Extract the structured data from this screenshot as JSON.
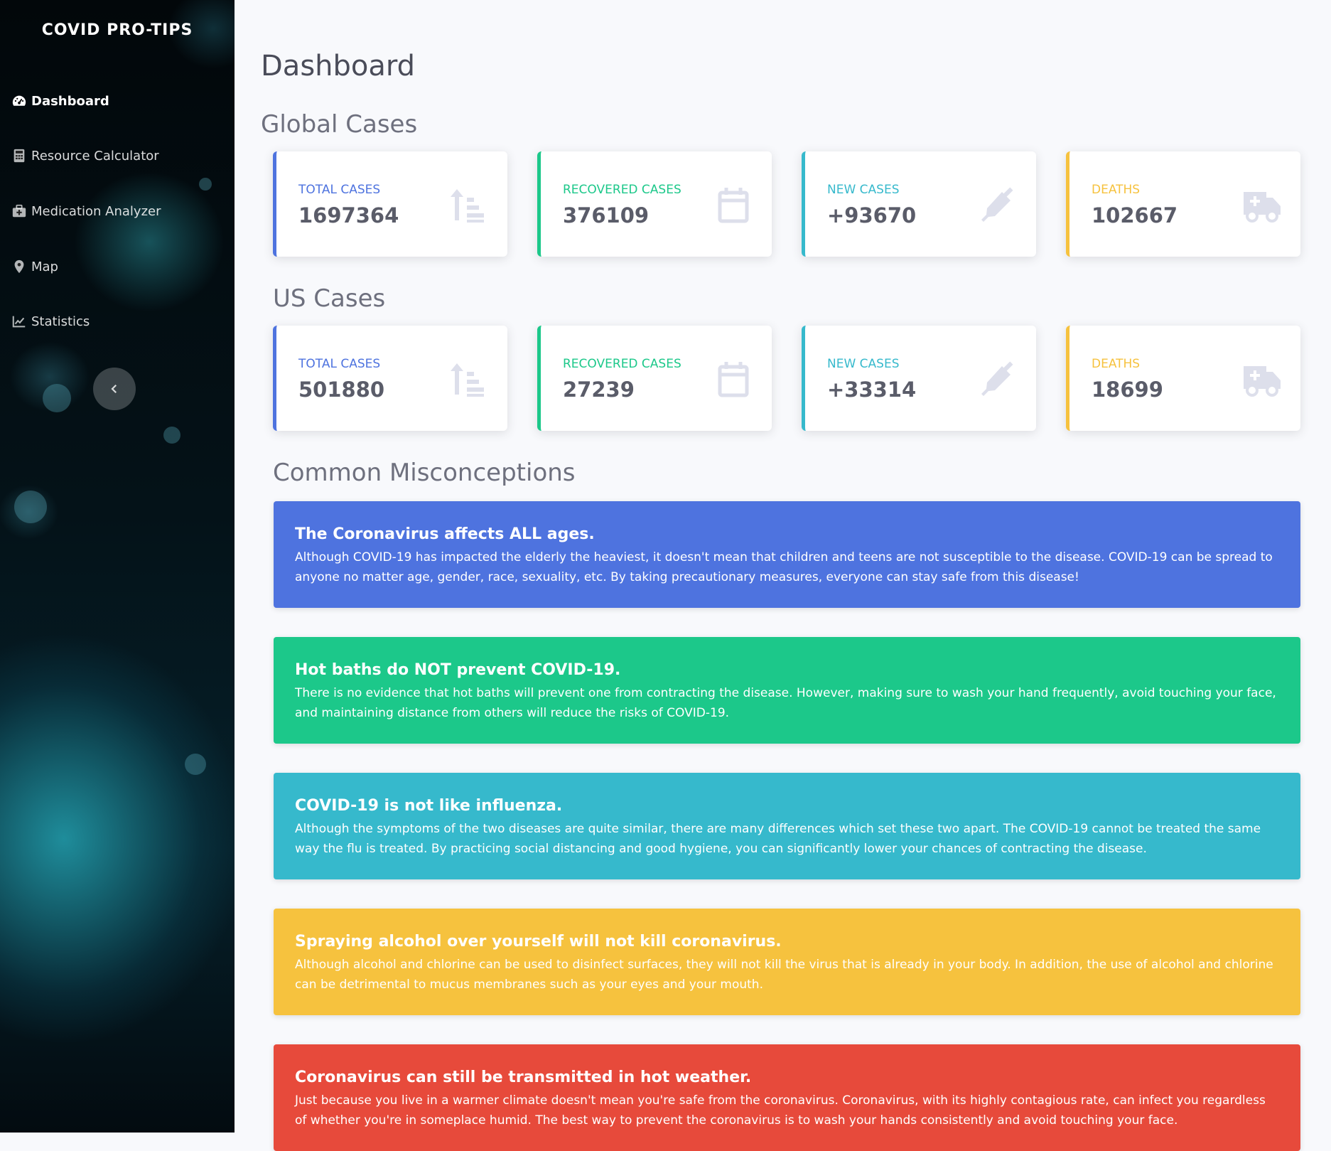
{
  "brand": "COVID PRO-TIPS",
  "sidebar": {
    "items": [
      {
        "label": "Dashboard",
        "icon": "tachometer-icon",
        "active": true
      },
      {
        "label": "Resource Calculator",
        "icon": "calculator-icon"
      },
      {
        "label": "Medication Analyzer",
        "icon": "medkit-icon"
      },
      {
        "label": "Map",
        "icon": "map-marker-icon"
      },
      {
        "label": "Statistics",
        "icon": "chart-line-icon"
      }
    ],
    "toggle_icon": "chevron-left-icon"
  },
  "page_title": "Dashboard",
  "global": {
    "title": "Global Cases",
    "cards": [
      {
        "label": "TOTAL CASES",
        "value": "1697364",
        "icon": "sort-amount-up-icon",
        "color": "#4e73df"
      },
      {
        "label": "RECOVERED CASES",
        "value": "376109",
        "icon": "calendar-icon",
        "color": "#1cc88a"
      },
      {
        "label": "NEW CASES",
        "value": "+93670",
        "icon": "syringe-icon",
        "color": "#36b9cc"
      },
      {
        "label": "DEATHS",
        "value": "102667",
        "icon": "ambulance-icon",
        "color": "#f6c23e"
      }
    ]
  },
  "us": {
    "title": "US Cases",
    "cards": [
      {
        "label": "TOTAL CASES",
        "value": "501880",
        "icon": "sort-amount-up-icon",
        "color": "#4e73df"
      },
      {
        "label": "RECOVERED CASES",
        "value": "27239",
        "icon": "calendar-icon",
        "color": "#1cc88a"
      },
      {
        "label": "NEW CASES",
        "value": "+33314",
        "icon": "syringe-icon",
        "color": "#36b9cc"
      },
      {
        "label": "DEATHS",
        "value": "18699",
        "icon": "ambulance-icon",
        "color": "#f6c23e"
      }
    ]
  },
  "misconceptions": {
    "title": "Common Misconceptions",
    "items": [
      {
        "title": "The Coronavirus affects ALL ages.",
        "body": "Although COVID-19 has impacted the elderly the heaviest, it doesn't mean that children and teens are not susceptible to the disease. COVID-19 can be spread to anyone no matter age, gender, race, sexuality, etc. By taking precautionary measures, everyone can stay safe from this disease!",
        "color": "#4e73df"
      },
      {
        "title": "Hot baths do NOT prevent COVID-19.",
        "body": "There is no evidence that hot baths will prevent one from contracting the disease. However, making sure to wash your hand frequently, avoid touching your face, and maintaining distance from others will reduce the risks of COVID-19.",
        "color": "#1cc88a"
      },
      {
        "title": "COVID-19 is not like influenza.",
        "body": "Although the symptoms of the two diseases are quite similar, there are many differences which set these two apart. The COVID-19 cannot be treated the same way the flu is treated. By practicing social distancing and good hygiene, you can significantly lower your chances of contracting the disease.",
        "color": "#36b9cc"
      },
      {
        "title": "Spraying alcohol over yourself will not kill coronavirus.",
        "body": "Although alcohol and chlorine can be used to disinfect surfaces, they will not kill the virus that is already in your body. In addition, the use of alcohol and chlorine can be detrimental  to mucus membranes  such as your eyes and your mouth.",
        "color": "#f6c23e"
      },
      {
        "title": "Coronavirus can still be transmitted in hot weather.",
        "body": "Just because you live in a warmer climate doesn't mean you're safe from the coronavirus. Coronavirus, with its highly contagious rate, can infect you regardless of whether you're in someplace humid. The best way to prevent the coronavirus is to wash your hands consistently and avoid touching your face.",
        "color": "#e74a3b"
      }
    ]
  }
}
